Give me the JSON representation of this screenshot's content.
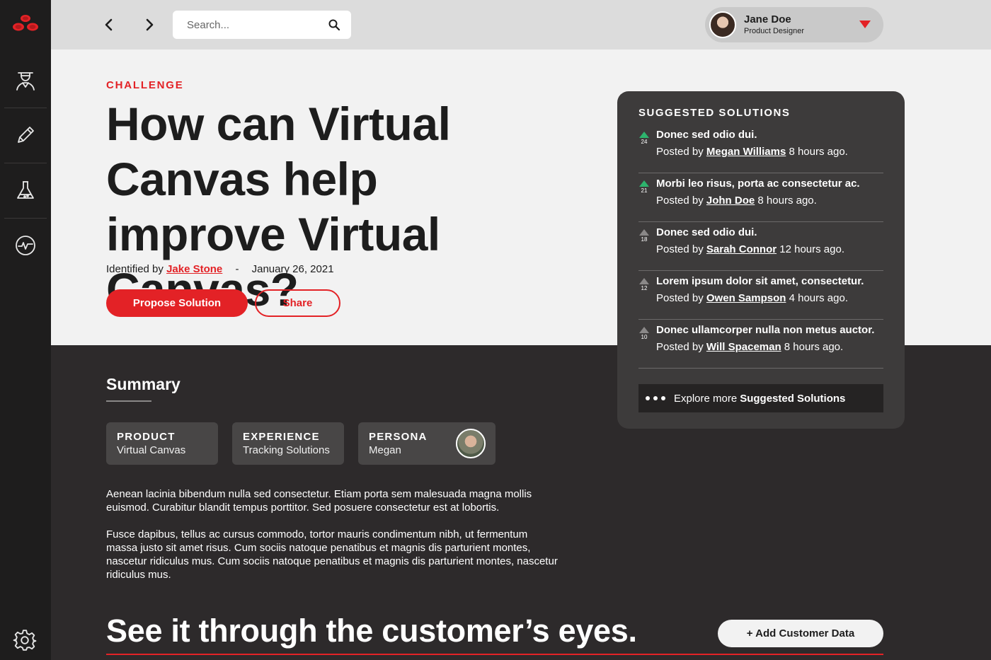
{
  "colors": {
    "accent": "#e32226",
    "upvote": "#2db46d",
    "sidebar": "#1e1d1d",
    "dark_bg": "#2d2a2b",
    "card_bg": "#3d3b3b",
    "light_bg": "#f2f2f2"
  },
  "sidebar": {
    "logo": "brand-logo-icon",
    "items": [
      {
        "icon": "persona-icon"
      },
      {
        "icon": "pencil-icon"
      },
      {
        "icon": "flask-icon"
      },
      {
        "icon": "pulse-icon"
      }
    ],
    "settings_icon": "gear-icon"
  },
  "topbar": {
    "back_icon": "chevron-left-icon",
    "forward_icon": "chevron-right-icon",
    "search": {
      "placeholder": "Search...",
      "value": ""
    },
    "user": {
      "name": "Jane Doe",
      "role": "Product Designer"
    }
  },
  "hero": {
    "kicker": "CHALLENGE",
    "title": "How can Virtual Canvas help improve Virtual Canvas?",
    "identified_label": "Identified by",
    "identified_by": "Jake Stone",
    "separator": "-",
    "date": "January 26, 2021",
    "primary_button": "Propose Solution",
    "secondary_button": "Share"
  },
  "suggested": {
    "title": "SUGGESTED SOLUTIONS",
    "posted_by_label": "Posted by",
    "items": [
      {
        "votes": "24",
        "title": "Donec sed odio dui.",
        "author": "Megan Williams",
        "time": "8 hours ago."
      },
      {
        "votes": "21",
        "title": "Morbi leo risus, porta ac consectetur ac.",
        "author": "John Doe",
        "time": "8 hours ago."
      },
      {
        "votes": "18",
        "title": "Donec sed odio dui.",
        "author": "Sarah Connor",
        "time": "12 hours ago."
      },
      {
        "votes": "12",
        "title": "Lorem ipsum dolor sit amet, consectetur.",
        "author": "Owen Sampson",
        "time": "4 hours ago."
      },
      {
        "votes": "10",
        "title": "Donec ullamcorper nulla non metus auctor.",
        "author": "Will Spaceman",
        "time": "8 hours ago."
      }
    ],
    "explore_prefix": "Explore more",
    "explore_bold": "Suggested Solutions"
  },
  "summary": {
    "heading": "Summary",
    "chips": [
      {
        "key": "PRODUCT",
        "value": "Virtual Canvas"
      },
      {
        "key": "EXPERIENCE",
        "value": "Tracking Solutions"
      },
      {
        "key": "PERSONA",
        "value": "Megan"
      }
    ],
    "paragraphs": [
      "Aenean lacinia bibendum nulla sed consectetur. Etiam porta sem malesuada magna mollis euismod. Curabitur blandit tempus porttitor. Sed posuere consectetur est at lobortis.",
      "Fusce dapibus, tellus ac cursus commodo, tortor mauris condimentum nibh, ut fermentum massa justo sit amet risus. Cum sociis natoque penatibus et magnis dis parturient montes, nascetur ridiculus mus. Cum sociis natoque penatibus et magnis dis parturient montes, nascetur ridiculus mus."
    ]
  },
  "customer": {
    "heading": "See it through the customer’s eyes.",
    "add_button": "+ Add Customer Data"
  }
}
